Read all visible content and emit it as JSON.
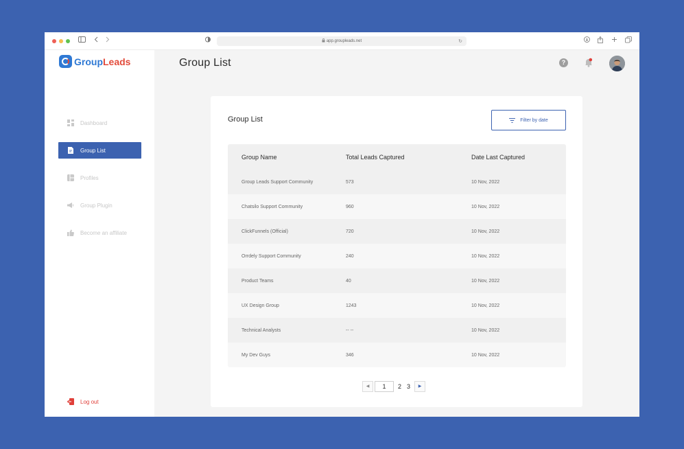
{
  "browser": {
    "url": "app.groupleads.net"
  },
  "brand": {
    "name_part1": "Group",
    "name_part2": "Leads",
    "color_primary": "#2f79d4",
    "color_secondary": "#e24b3b"
  },
  "sidebar": {
    "items": [
      {
        "label": "Dashboard",
        "icon": "dashboard-icon",
        "active": false
      },
      {
        "label": "Group List",
        "icon": "document-icon",
        "active": true
      },
      {
        "label": "Profiles",
        "icon": "profiles-icon",
        "active": false
      },
      {
        "label": "Group Plugin",
        "icon": "megaphone-icon",
        "active": false
      },
      {
        "label": "Become an affiliate",
        "icon": "thumbs-up-icon",
        "active": false
      }
    ],
    "logout_label": "Log out"
  },
  "header": {
    "title": "Group List"
  },
  "card": {
    "title": "Group List",
    "filter_label": "Filter by date"
  },
  "table": {
    "columns": [
      "Group Name",
      "Total Leads Captured",
      "Date Last Captured"
    ],
    "rows": [
      [
        "Group Leads Support Community",
        "573",
        "10 Nov, 2022"
      ],
      [
        "Chatsilo Support Community",
        "960",
        "10 Nov, 2022"
      ],
      [
        "ClickFunnels (Official)",
        "720",
        "10 Nov, 2022"
      ],
      [
        "Orrdely Support Community",
        "240",
        "10 Nov, 2022"
      ],
      [
        "Product Teams",
        "40",
        "10 Nov, 2022"
      ],
      [
        "UX Design Group",
        "1243",
        "10 Nov, 2022"
      ],
      [
        "Technical Analysts",
        "-- --",
        "10 Nov, 2022"
      ],
      [
        "My Dev Guys",
        "346",
        "10 Nov, 2022"
      ]
    ]
  },
  "pagination": {
    "current": "1",
    "pages": [
      "2",
      "3"
    ]
  },
  "colors": {
    "accent": "#3c62b0",
    "danger": "#e0403a"
  }
}
